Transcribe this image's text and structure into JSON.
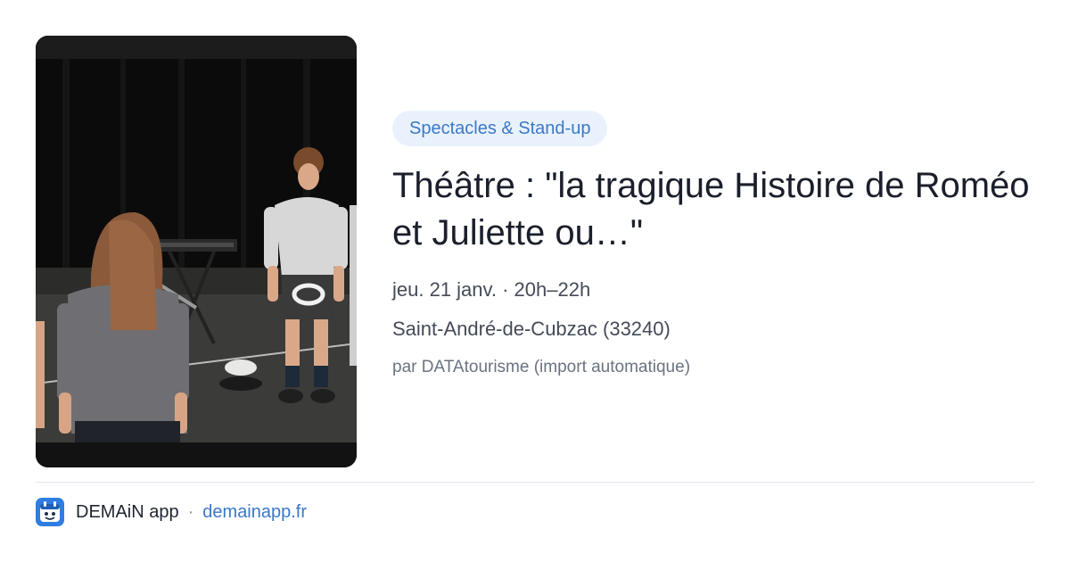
{
  "event": {
    "category": "Spectacles & Stand-up",
    "title": "Théâtre : \"la tragique Histoire de Roméo et Juliette ou…\"",
    "datetime": "jeu. 21 janv. · 20h–22h",
    "location": "Saint-André-de-Cubzac (33240)",
    "source": "par DATAtourisme (import automatique)"
  },
  "footer": {
    "app_name": "DEMAiN app",
    "separator": "·",
    "domain": "demainapp.fr"
  },
  "icons": {
    "photo": "event-photo",
    "app": "demain-app-icon"
  },
  "colors": {
    "accent": "#3b78c8",
    "category_bg": "#e9f2fc",
    "divider": "#dde4ec"
  }
}
